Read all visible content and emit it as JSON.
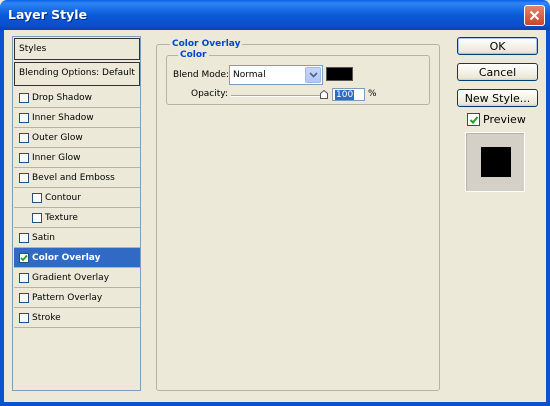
{
  "window": {
    "title": "Layer Style"
  },
  "styles_panel": {
    "header": "Styles",
    "blending_options": "Blending Options: Default",
    "items": [
      {
        "label": "Drop Shadow",
        "checked": false,
        "indent": false,
        "selected": false
      },
      {
        "label": "Inner Shadow",
        "checked": false,
        "indent": false,
        "selected": false
      },
      {
        "label": "Outer Glow",
        "checked": false,
        "indent": false,
        "selected": false
      },
      {
        "label": "Inner Glow",
        "checked": false,
        "indent": false,
        "selected": false
      },
      {
        "label": "Bevel and Emboss",
        "checked": false,
        "indent": false,
        "selected": false
      },
      {
        "label": "Contour",
        "checked": false,
        "indent": true,
        "selected": false
      },
      {
        "label": "Texture",
        "checked": false,
        "indent": true,
        "selected": false
      },
      {
        "label": "Satin",
        "checked": false,
        "indent": false,
        "selected": false
      },
      {
        "label": "Color Overlay",
        "checked": true,
        "indent": false,
        "selected": true
      },
      {
        "label": "Gradient Overlay",
        "checked": false,
        "indent": false,
        "selected": false
      },
      {
        "label": "Pattern Overlay",
        "checked": false,
        "indent": false,
        "selected": false
      },
      {
        "label": "Stroke",
        "checked": false,
        "indent": false,
        "selected": false
      }
    ]
  },
  "color_overlay": {
    "group_title": "Color Overlay",
    "section_title": "Color",
    "blend_mode_label": "Blend Mode:",
    "blend_mode_value": "Normal",
    "overlay_color": "#000000",
    "opacity_label": "Opacity:",
    "opacity_value": "100",
    "opacity_unit": "%",
    "opacity_level": 1.0
  },
  "buttons": {
    "ok": "OK",
    "cancel": "Cancel",
    "new_style": "New Style..."
  },
  "preview": {
    "label": "Preview",
    "checked": true,
    "swatch_color": "#000000"
  },
  "colors": {
    "accent": "#316ac5",
    "titlebar": "#0a5fe4",
    "legend": "#0046d5"
  }
}
